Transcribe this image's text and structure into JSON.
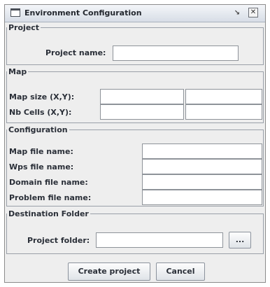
{
  "window": {
    "title": "Environment Configuration",
    "restore_glyph": "↘",
    "close_glyph": "✕",
    "icons": {
      "app": "window-icon",
      "restore": "restore-icon",
      "close": "close-icon"
    }
  },
  "project": {
    "legend": "Project",
    "name_label": "Project name:",
    "name_value": ""
  },
  "map": {
    "legend": "Map",
    "size_label": "Map size (X,Y):",
    "size_x": "",
    "size_y": "",
    "cells_label": "Nb Cells (X,Y):",
    "cells_x": "",
    "cells_y": ""
  },
  "configuration": {
    "legend": "Configuration",
    "map_file_label": "Map file name:",
    "map_file_value": "",
    "wps_file_label": "Wps file name:",
    "wps_file_value": "",
    "domain_file_label": "Domain file name:",
    "domain_file_value": "",
    "problem_file_label": "Problem file name:",
    "problem_file_value": ""
  },
  "destination": {
    "legend": "Destination Folder",
    "folder_label": "Project folder:",
    "folder_value": "",
    "browse_label": "..."
  },
  "actions": {
    "create_label": "Create project",
    "cancel_label": "Cancel"
  }
}
